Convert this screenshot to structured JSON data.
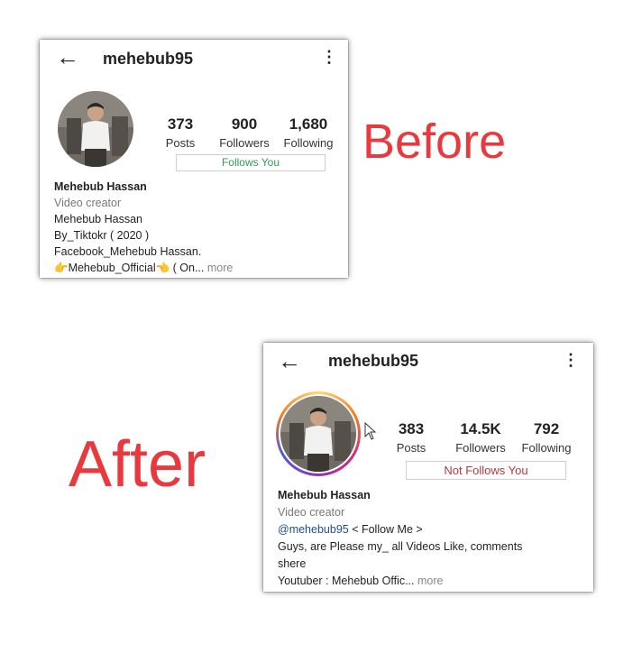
{
  "labels": {
    "before": "Before",
    "after": "After"
  },
  "before": {
    "username": "mehebub95",
    "back_icon": "←",
    "menu_icon": "⋮",
    "stats": {
      "posts": {
        "value": "373",
        "label": "Posts"
      },
      "followers": {
        "value": "900",
        "label": "Followers"
      },
      "following": {
        "value": "1,680",
        "label": "Following"
      }
    },
    "follow_status": "Follows You",
    "bio": {
      "name": "Mehebub Hassan",
      "category": "Video creator",
      "lines": [
        "Mehebub Hassan",
        "By_Tiktokr ( 2020 )",
        "Facebook_Mehebub Hassan."
      ],
      "last_line": "👉Mehebub_Official👈 ( On...",
      "more": "more"
    }
  },
  "after": {
    "username": "mehebub95",
    "back_icon": "←",
    "menu_icon": "⋮",
    "stats": {
      "posts": {
        "value": "383",
        "label": "Posts"
      },
      "followers": {
        "value": "14.5K",
        "label": "Followers"
      },
      "following": {
        "value": "792",
        "label": "Following"
      }
    },
    "follow_status": "Not Follows You",
    "bio": {
      "name": "Mehebub Hassan",
      "category": "Video creator",
      "mention": "@mehebub95",
      "mention_suffix": " < Follow Me >",
      "line1": "Guys, are Please my_ all Videos Like, comments",
      "line2": "shere",
      "last_line": "Youtuber : Mehebub Offic...",
      "more": "more"
    }
  },
  "colors": {
    "label_red": "#e8393f",
    "follows_green": "#2f9e52",
    "not_follows_red": "#b23a3a",
    "story_ring": [
      "#feda75",
      "#fa7e1e",
      "#d62976",
      "#962fbf",
      "#4f5bd5"
    ]
  }
}
